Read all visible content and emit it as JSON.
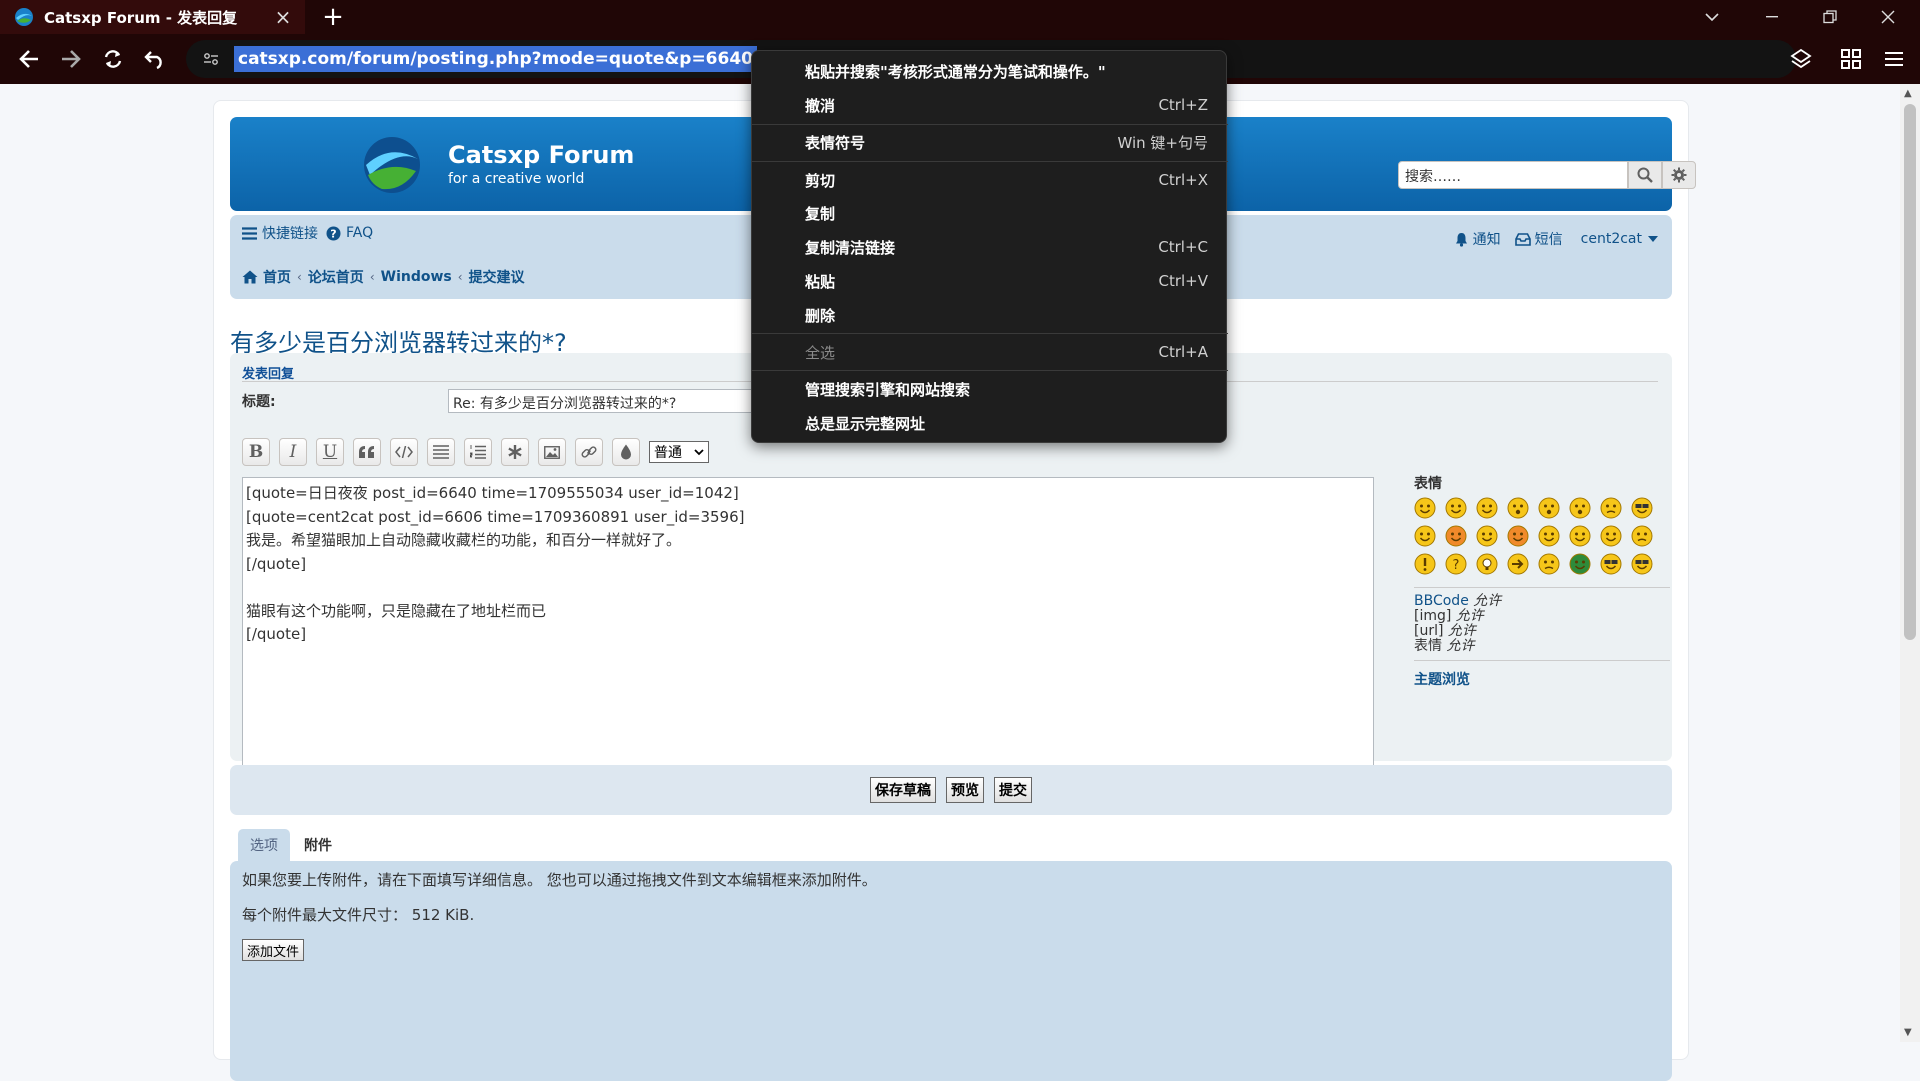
{
  "browser": {
    "tab_title": "Catsxp Forum - 发表回复",
    "url": "catsxp.com/forum/posting.php?mode=quote&p=6640",
    "colors": {
      "chrome": "#200606",
      "tab_active": "#330b0b",
      "url_selection": "#3b6fd6"
    }
  },
  "header": {
    "site_title": "Catsxp Forum",
    "site_desc": "for a creative world",
    "search_placeholder": "搜索……"
  },
  "nav": {
    "quick_links": "快捷链接",
    "faq": "FAQ",
    "notifications": "通知",
    "pm": "短信",
    "username": "cent2cat",
    "breadcrumbs": [
      "首页",
      "论坛首页",
      "Windows",
      "提交建议"
    ]
  },
  "topic": {
    "title": "有多少是百分浏览器转过来的*?"
  },
  "post_form": {
    "heading": "发表回复",
    "subject_label": "标题:",
    "subject_value": "Re: 有多少是百分浏览器转过来的*?",
    "font_size_value": "普通",
    "message": "[quote=日日夜夜 post_id=6640 time=1709555034 user_id=1042]\n[quote=cent2cat post_id=6606 time=1709360891 user_id=3596]\n我是。希望猫眼加上自动隐藏收藏栏的功能，和百分一样就好了。\n[/quote]\n\n猫眼有这个功能啊，只是隐藏在了地址栏而已\n[/quote]"
  },
  "smilies": {
    "heading": "表情",
    "bbcode_label": "BBCode",
    "img_label": "[img]",
    "url_label": "[url]",
    "smilies_label": "表情",
    "allowed": "允许",
    "topic_review": "主题浏览"
  },
  "buttons": {
    "save_draft": "保存草稿",
    "preview": "预览",
    "submit": "提交"
  },
  "tabs": {
    "options": "选项",
    "attachments": "附件"
  },
  "attachments": {
    "info": "如果您要上传附件，请在下面填写详细信息。 您也可以通过拖拽文件到文本编辑框来添加附件。",
    "max_size": "每个附件最大文件尺寸： 512 KiB.",
    "add_file": "添加文件"
  },
  "context_menu": {
    "paste_search": "粘贴并搜索\"考核形式通常分为笔试和操作。\"",
    "undo": "撤消",
    "undo_sc": "Ctrl+Z",
    "emoji": "表情符号",
    "emoji_sc": "Win 键+句号",
    "cut": "剪切",
    "cut_sc": "Ctrl+X",
    "copy": "复制",
    "copy_clean": "复制清洁链接",
    "copy_clean_sc": "Ctrl+C",
    "paste": "粘贴",
    "paste_sc": "Ctrl+V",
    "delete": "删除",
    "select_all": "全选",
    "select_all_sc": "Ctrl+A",
    "manage_search": "管理搜索引擎和网站搜索",
    "always_full_url": "总是显示完整网址"
  }
}
